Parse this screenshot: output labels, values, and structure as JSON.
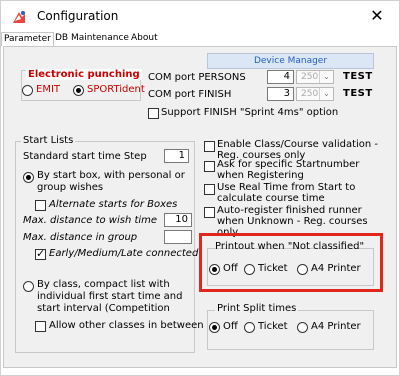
{
  "window": {
    "title": "Configuration",
    "close_glyph": "✕",
    "app_icon": "app-icon"
  },
  "tabs": [
    {
      "label": "Parameter",
      "active": true
    },
    {
      "label": "DB Maintenance",
      "active": false
    },
    {
      "label": "About",
      "active": false
    }
  ],
  "device_manager": {
    "label": "Device Manager"
  },
  "electronic_punching": {
    "label": "Electronic punching",
    "options": [
      {
        "label": "EMIT",
        "selected": false
      },
      {
        "label": "SPORTident",
        "selected": true
      }
    ],
    "label_color": "#cc0000"
  },
  "com_ports": [
    {
      "label": "COM port PERSONS",
      "port": "4",
      "baud": "250",
      "test_label": "TEST"
    },
    {
      "label": "COM port FINISH",
      "port": "3",
      "baud": "250",
      "test_label": "TEST"
    }
  ],
  "sprint_option": {
    "label": "Support FINISH \"Sprint 4ms\" option",
    "checked": false
  },
  "start_lists": {
    "group_label": "Start Lists",
    "standard_step_label": "Standard start time Step",
    "standard_step_value": "1",
    "by_start_box": {
      "label": "By start box, with personal or group wishes",
      "selected": true
    },
    "alternate_starts": {
      "label": "Alternate starts for Boxes",
      "checked": false
    },
    "max_distance_wish": {
      "label": "Max. distance to wish time",
      "value": "10"
    },
    "max_distance_group": {
      "label": "Max. distance in group",
      "value": ""
    },
    "early_medium_late": {
      "label": "Early/Medium/Late connected",
      "checked": true
    },
    "by_class": {
      "label": "By class, compact list with individual first start time and start interval (Competition definition)",
      "selected": false
    },
    "allow_other_classes": {
      "label": "Allow other classes in between",
      "checked": false
    }
  },
  "options": [
    {
      "label": "Enable Class/Course validation - Reg. courses only",
      "checked": false
    },
    {
      "label": "Ask for specific Startnumber when Registering",
      "checked": false
    },
    {
      "label": "Use Real Time from Start to calculate course time",
      "checked": false
    },
    {
      "label": "Auto-register finished runner when Unknown - Reg. courses only",
      "checked": false
    }
  ],
  "printout_not_classified": {
    "label": "Printout when \"Not classified\"",
    "options": [
      {
        "label": "Off",
        "selected": true
      },
      {
        "label": "Ticket",
        "selected": false
      },
      {
        "label": "A4 Printer",
        "selected": false
      }
    ],
    "highlight_color": "#e1261c"
  },
  "print_split_times": {
    "label": "Print Split times",
    "options": [
      {
        "label": "Off",
        "selected": true
      },
      {
        "label": "Ticket",
        "selected": false
      },
      {
        "label": "A4 Printer",
        "selected": false
      }
    ]
  }
}
